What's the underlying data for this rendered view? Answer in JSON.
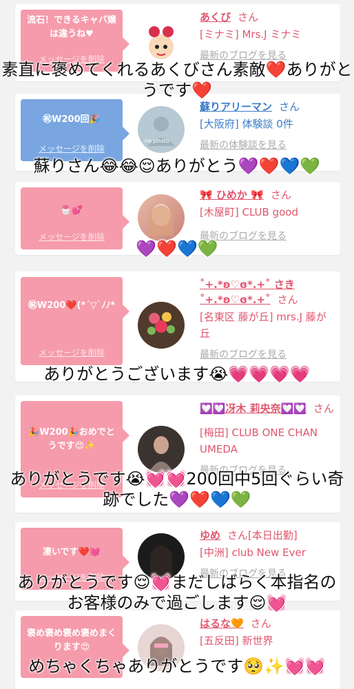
{
  "cards": [
    {
      "message": "流石！できるキャバ嬢は違うね♥",
      "delete": "メッセージを削除",
      "name": "あくび",
      "san": "さん",
      "location": "[ミナミ] Mrs.J ミナミ",
      "link": "最新のブログを見る"
    },
    {
      "message": "㊗W200回🎉",
      "delete": "メッセージを削除",
      "name": "蘇りアリーマン",
      "san": "さん",
      "location": "[大阪府] 体験談 0件",
      "link": "最新の体験談を見る",
      "avatar_text": "no photo"
    },
    {
      "message": "🍧💕",
      "delete": "メッセージを削除",
      "name": "🎀 ひめか 🎀",
      "san": "さん",
      "location": "[木屋町] CLUB good",
      "link": "最新のブログを見る"
    },
    {
      "message": "㊗W200❤️(*´▽`ﾉﾉ*",
      "delete": "メッセージを削除",
      "name": "˚+.*ʚ♡ɞ*.+˚ さき˚+.*ʚ♡ɞ*.+˚",
      "san": "さん",
      "location": "[名東区 藤が丘] mrs.J 藤が丘",
      "link": "最新のブログを見る"
    },
    {
      "message": "🎉W200🎉おめでとうです😍✨",
      "delete": "メッセージを削除",
      "name": "💟💟冴木 莉央奈💟💟",
      "san": "さん",
      "location": "[梅田] CLUB ONE CHAN UMEDA",
      "link": "最新のブログを見る"
    },
    {
      "message": "凄いです❤️💓",
      "delete": "メッセージを削除",
      "name": "ゆめ",
      "san": "さん[本日出勤]",
      "location": "[中洲] club New Ever",
      "link": "最新のブログを見る"
    },
    {
      "message": "褒め褒め褒め褒めまくります😍",
      "delete": "メッセージを削除",
      "name": "はるな🧡",
      "san": "さん",
      "location": "[五反田] 新世界",
      "link": ""
    }
  ],
  "captions": [
    "素直に褒めてくれるあくびさん素敵❤️ありがとうです❤️",
    "蘇りさん😂😂😌ありがとう💜❤️💙💚",
    "💜❤️💙💚",
    "ありがとうございます😭💗💗💗💗",
    "ありがとうです😭💓💓200回中5回ぐらい奇跡でした💜❤️💙💚",
    "ありがとうです😌💓まだしばらく本指名のお客様のみで過ごします😌💓",
    "めちゃくちゃありがとうです🥺✨💓💓"
  ],
  "colors": {
    "pink": "#f59bab",
    "blue": "#79a6e0",
    "name_pink": "#e0566d",
    "name_blue": "#3a7bc8"
  }
}
